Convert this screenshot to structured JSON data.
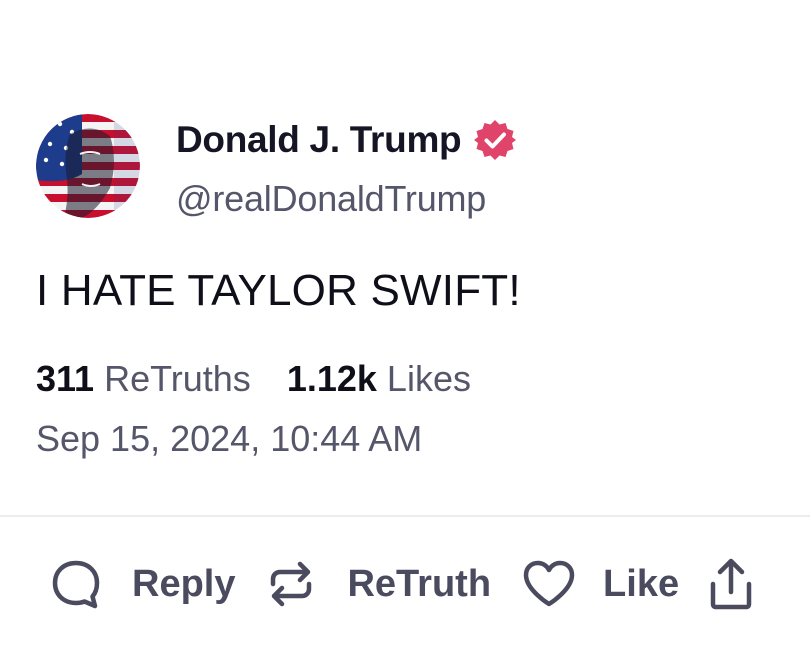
{
  "post": {
    "author": {
      "display_name": "Donald J. Trump",
      "handle": "@realDonaldTrump",
      "verified": true,
      "verified_color": "#e0446b"
    },
    "text": "I HATE TAYLOR SWIFT!",
    "stats": {
      "retruths_count": "311",
      "retruths_label": "ReTruths",
      "likes_count": "1.12k",
      "likes_label": "Likes"
    },
    "timestamp": "Sep 15, 2024, 10:44 AM"
  },
  "actions": {
    "reply_label": "Reply",
    "retruth_label": "ReTruth",
    "like_label": "Like"
  },
  "icons": {
    "reply": "speech-bubble-icon",
    "retruth": "repost-arrows-icon",
    "like": "heart-icon",
    "share": "share-upload-icon",
    "verified": "verified-badge-icon"
  },
  "colors": {
    "text_primary": "#0f0f1a",
    "text_secondary": "#55566a",
    "action_gray": "#4a4b5e",
    "divider": "#ececf0"
  }
}
